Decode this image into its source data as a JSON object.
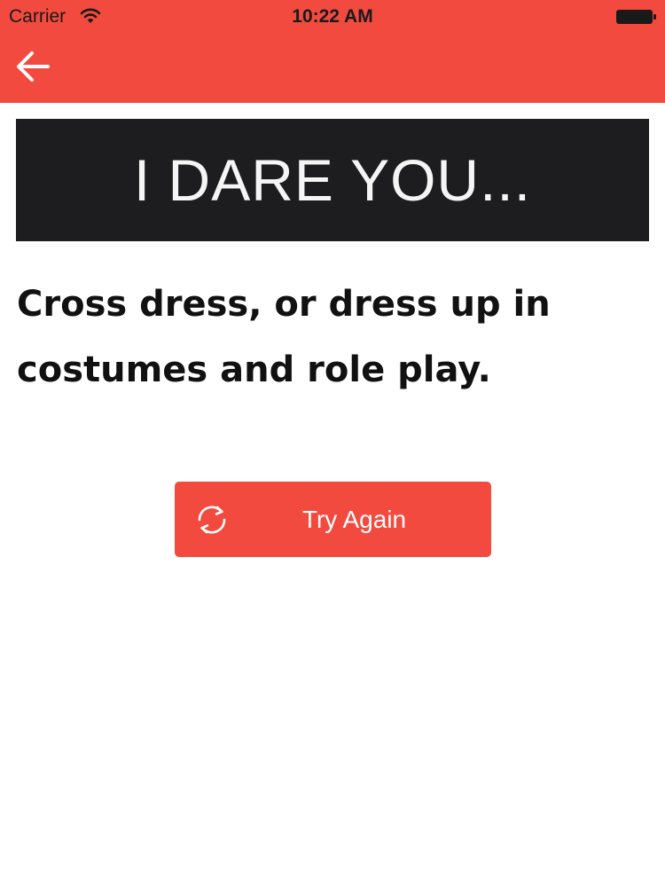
{
  "status_bar": {
    "carrier": "Carrier",
    "time": "10:22 AM",
    "wifi_icon": "wifi-icon",
    "battery_icon": "battery-icon"
  },
  "nav": {
    "back_icon": "arrow-left-icon",
    "color": "#f24a3f"
  },
  "banner": {
    "text": "I DARE YOU...",
    "background": "#1d1d1f"
  },
  "dare": {
    "text": "Cross dress, or dress up in costumes and role play."
  },
  "actions": {
    "try_again_label": "Try Again",
    "try_again_icon": "refresh-icon",
    "color": "#f24a3f"
  }
}
